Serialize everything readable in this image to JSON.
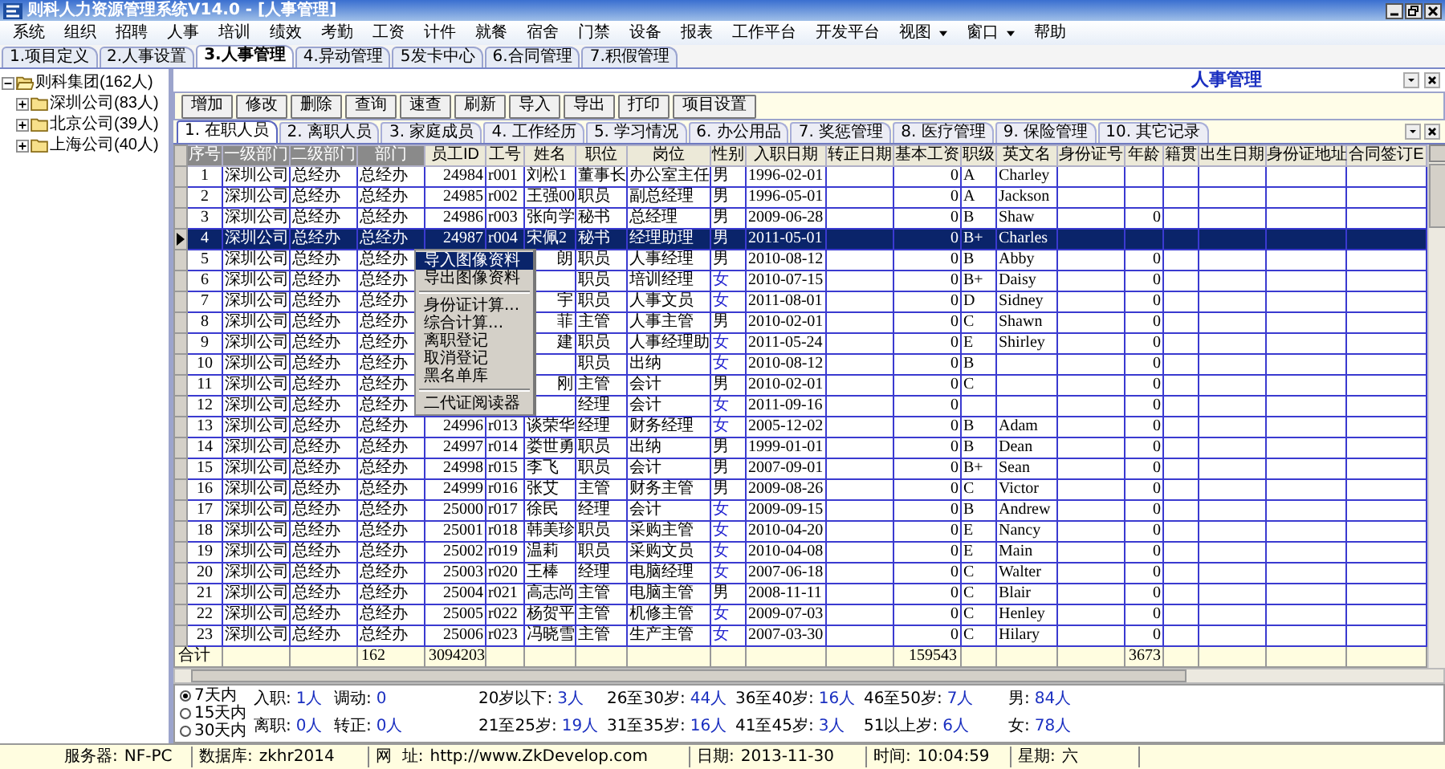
{
  "window": {
    "title": "则科人力资源管理系统V14.0 - [人事管理]"
  },
  "menu": [
    {
      "label": "系统",
      "dropdown": false
    },
    {
      "label": "组织",
      "dropdown": false
    },
    {
      "label": "招聘",
      "dropdown": false
    },
    {
      "label": "人事",
      "dropdown": false
    },
    {
      "label": "培训",
      "dropdown": false
    },
    {
      "label": "绩效",
      "dropdown": false
    },
    {
      "label": "考勤",
      "dropdown": false
    },
    {
      "label": "工资",
      "dropdown": false
    },
    {
      "label": "计件",
      "dropdown": false
    },
    {
      "label": "就餐",
      "dropdown": false
    },
    {
      "label": "宿舍",
      "dropdown": false
    },
    {
      "label": "门禁",
      "dropdown": false
    },
    {
      "label": "设备",
      "dropdown": false
    },
    {
      "label": "报表",
      "dropdown": false
    },
    {
      "label": "工作平台",
      "dropdown": false
    },
    {
      "label": "开发平台",
      "dropdown": false
    },
    {
      "label": "视图",
      "dropdown": true
    },
    {
      "label": "窗口",
      "dropdown": true
    },
    {
      "label": "帮助",
      "dropdown": false
    }
  ],
  "module_tabs": [
    {
      "label": "1.项目定义",
      "selected": false
    },
    {
      "label": "2.人事设置",
      "selected": false
    },
    {
      "label": "3.人事管理",
      "selected": true
    },
    {
      "label": "4.异动管理",
      "selected": false
    },
    {
      "label": "5发卡中心",
      "selected": false
    },
    {
      "label": "6.合同管理",
      "selected": false
    },
    {
      "label": "7.积假管理",
      "selected": false
    }
  ],
  "tree": {
    "label": "则科集团(162人)",
    "expanded": true,
    "children": [
      {
        "label": "深圳公司(83人)",
        "expanded": false
      },
      {
        "label": "北京公司(39人)",
        "expanded": false
      },
      {
        "label": "上海公司(40人)",
        "expanded": false
      }
    ]
  },
  "panel": {
    "title": "人事管理"
  },
  "toolbar": [
    "增加",
    "修改",
    "删除",
    "查询",
    "速查",
    "刷新",
    "导入",
    "导出",
    "打印",
    "项目设置"
  ],
  "record_tabs": [
    {
      "label": "1. 在职人员",
      "selected": true
    },
    {
      "label": "2. 离职人员",
      "selected": false
    },
    {
      "label": "3. 家庭成员",
      "selected": false
    },
    {
      "label": "4. 工作经历",
      "selected": false
    },
    {
      "label": "5. 学习情况",
      "selected": false
    },
    {
      "label": "6. 办公用品",
      "selected": false
    },
    {
      "label": "7. 奖惩管理",
      "selected": false
    },
    {
      "label": "8. 医疗管理",
      "selected": false
    },
    {
      "label": "9. 保险管理",
      "selected": false
    },
    {
      "label": "10. 其它记录",
      "selected": false
    }
  ],
  "table": {
    "columns": [
      {
        "label": "序号",
        "dim": true,
        "kind": "text"
      },
      {
        "label": "一级部门",
        "dim": true,
        "kind": "text"
      },
      {
        "label": "二级部门",
        "dim": true,
        "kind": "text"
      },
      {
        "label": "部门",
        "dim": true,
        "kind": "text"
      },
      {
        "label": "员工ID",
        "dim": false,
        "kind": "number"
      },
      {
        "label": "工号",
        "dim": false,
        "kind": "text"
      },
      {
        "label": "姓名",
        "dim": false,
        "kind": "text"
      },
      {
        "label": "职位",
        "dim": false,
        "kind": "text"
      },
      {
        "label": "岗位",
        "dim": false,
        "kind": "text"
      },
      {
        "label": "性别",
        "dim": false,
        "kind": "gender"
      },
      {
        "label": "入职日期",
        "dim": false,
        "kind": "text"
      },
      {
        "label": "转正日期",
        "dim": false,
        "kind": "text"
      },
      {
        "label": "基本工资",
        "dim": false,
        "kind": "number"
      },
      {
        "label": "职级",
        "dim": false,
        "kind": "text"
      },
      {
        "label": "英文名",
        "dim": false,
        "kind": "text"
      },
      {
        "label": "身份证号",
        "dim": false,
        "kind": "text"
      },
      {
        "label": "年龄",
        "dim": false,
        "kind": "number"
      },
      {
        "label": "籍贯",
        "dim": false,
        "kind": "text"
      },
      {
        "label": "出生日期",
        "dim": false,
        "kind": "text"
      },
      {
        "label": "身份证地址",
        "dim": false,
        "kind": "text"
      },
      {
        "label": "合同签订E",
        "dim": false,
        "kind": "text"
      }
    ],
    "rows": [
      {
        "no": "1",
        "dept1": "深圳公司",
        "dept2": "总经办",
        "dept": "总经办",
        "emp_id": "24984",
        "emp_no": "r001",
        "name": "刘松1",
        "position": "董事长",
        "post": "办公室主任",
        "gender": "男",
        "hire_date": "1996-02-01",
        "base_salary": "0",
        "grade": "A",
        "english_name": "Charley",
        "selected": false,
        "gender_blue": false,
        "under_menu": false
      },
      {
        "no": "2",
        "dept1": "深圳公司",
        "dept2": "总经办",
        "dept": "总经办",
        "emp_id": "24985",
        "emp_no": "r002",
        "name": "王强00",
        "position": "职员",
        "post": "副总经理",
        "gender": "男",
        "hire_date": "1996-05-01",
        "base_salary": "0",
        "grade": "A",
        "english_name": "Jackson",
        "selected": false,
        "gender_blue": false,
        "under_menu": false
      },
      {
        "no": "3",
        "dept1": "深圳公司",
        "dept2": "总经办",
        "dept": "总经办",
        "emp_id": "24986",
        "emp_no": "r003",
        "name": "张向学",
        "position": "秘书",
        "post": "总经理",
        "gender": "男",
        "hire_date": "2009-06-28",
        "base_salary": "0",
        "grade": "B",
        "english_name": "Shaw",
        "age": "0",
        "selected": false,
        "gender_blue": false,
        "under_menu": false
      },
      {
        "no": "4",
        "dept1": "深圳公司",
        "dept2": "总经办",
        "dept": "总经办",
        "emp_id": "24987",
        "emp_no": "r004",
        "name": "宋佩2",
        "position": "秘书",
        "post": "经理助理",
        "gender": "男",
        "hire_date": "2011-05-01",
        "base_salary": "0",
        "grade": "B+",
        "english_name": "Charles",
        "selected": true,
        "gender_blue": false,
        "under_menu": false
      },
      {
        "no": "5",
        "dept1": "深圳公司",
        "dept2": "总经办",
        "dept": "总经办",
        "name": "朗",
        "position": "职员",
        "post": "人事经理",
        "gender": "男",
        "hire_date": "2010-08-12",
        "base_salary": "0",
        "grade": "B",
        "english_name": "Abby",
        "age": "0",
        "selected": false,
        "gender_blue": false,
        "under_menu": true
      },
      {
        "no": "6",
        "dept1": "深圳公司",
        "dept2": "总经办",
        "dept": "总经办",
        "position": "职员",
        "post": "培训经理",
        "gender": "女",
        "hire_date": "2010-07-15",
        "base_salary": "0",
        "grade": "B+",
        "english_name": "Daisy",
        "age": "0",
        "selected": false,
        "gender_blue": true,
        "under_menu": true
      },
      {
        "no": "7",
        "dept1": "深圳公司",
        "dept2": "总经办",
        "dept": "总经办",
        "name": "宇",
        "position": "职员",
        "post": "人事文员",
        "gender": "女",
        "hire_date": "2011-08-01",
        "base_salary": "0",
        "grade": "D",
        "english_name": "Sidney",
        "age": "0",
        "selected": false,
        "gender_blue": true,
        "under_menu": true
      },
      {
        "no": "8",
        "dept1": "深圳公司",
        "dept2": "总经办",
        "dept": "总经办",
        "name": "菲",
        "position": "主管",
        "post": "人事主管",
        "gender": "男",
        "hire_date": "2010-02-01",
        "base_salary": "0",
        "grade": "C",
        "english_name": "Shawn",
        "age": "0",
        "selected": false,
        "gender_blue": false,
        "under_menu": true
      },
      {
        "no": "9",
        "dept1": "深圳公司",
        "dept2": "总经办",
        "dept": "总经办",
        "name": "建",
        "position": "职员",
        "post": "人事经理助",
        "gender": "女",
        "hire_date": "2011-05-24",
        "base_salary": "0",
        "grade": "E",
        "english_name": "Shirley",
        "age": "0",
        "selected": false,
        "gender_blue": true,
        "under_menu": true
      },
      {
        "no": "10",
        "dept1": "深圳公司",
        "dept2": "总经办",
        "dept": "总经办",
        "position": "职员",
        "post": "出纳",
        "gender": "女",
        "hire_date": "2010-08-12",
        "base_salary": "0",
        "grade": "B",
        "age": "0",
        "selected": false,
        "gender_blue": true,
        "under_menu": true
      },
      {
        "no": "11",
        "dept1": "深圳公司",
        "dept2": "总经办",
        "dept": "总经办",
        "name": "刚",
        "position": "主管",
        "post": "会计",
        "gender": "男",
        "hire_date": "2010-02-01",
        "base_salary": "0",
        "grade": "C",
        "age": "0",
        "selected": false,
        "gender_blue": false,
        "under_menu": true
      },
      {
        "no": "12",
        "dept1": "深圳公司",
        "dept2": "总经办",
        "dept": "总经办",
        "position": "经理",
        "post": "会计",
        "gender": "女",
        "hire_date": "2011-09-16",
        "base_salary": "0",
        "age": "0",
        "selected": false,
        "gender_blue": true,
        "under_menu": true
      },
      {
        "no": "13",
        "dept1": "深圳公司",
        "dept2": "总经办",
        "dept": "总经办",
        "emp_id": "24996",
        "emp_no": "r013",
        "name": "谈荣华",
        "position": "经理",
        "post": "财务经理",
        "gender": "女",
        "hire_date": "2005-12-02",
        "base_salary": "0",
        "grade": "B",
        "english_name": "Adam",
        "age": "0",
        "selected": false,
        "gender_blue": true,
        "under_menu": false
      },
      {
        "no": "14",
        "dept1": "深圳公司",
        "dept2": "总经办",
        "dept": "总经办",
        "emp_id": "24997",
        "emp_no": "r014",
        "name": "娄世勇",
        "position": "职员",
        "post": "出纳",
        "gender": "男",
        "hire_date": "1999-01-01",
        "base_salary": "0",
        "grade": "B",
        "english_name": "Dean",
        "age": "0",
        "selected": false,
        "gender_blue": false,
        "under_menu": false
      },
      {
        "no": "15",
        "dept1": "深圳公司",
        "dept2": "总经办",
        "dept": "总经办",
        "emp_id": "24998",
        "emp_no": "r015",
        "name": "李飞",
        "position": "职员",
        "post": "会计",
        "gender": "男",
        "hire_date": "2007-09-01",
        "base_salary": "0",
        "grade": "B+",
        "english_name": "Sean",
        "age": "0",
        "selected": false,
        "gender_blue": false,
        "under_menu": false
      },
      {
        "no": "16",
        "dept1": "深圳公司",
        "dept2": "总经办",
        "dept": "总经办",
        "emp_id": "24999",
        "emp_no": "r016",
        "name": "张艾",
        "position": "主管",
        "post": "财务主管",
        "gender": "男",
        "hire_date": "2009-08-26",
        "base_salary": "0",
        "grade": "C",
        "english_name": "Victor",
        "age": "0",
        "selected": false,
        "gender_blue": false,
        "under_menu": false
      },
      {
        "no": "17",
        "dept1": "深圳公司",
        "dept2": "总经办",
        "dept": "总经办",
        "emp_id": "25000",
        "emp_no": "r017",
        "name": "徐民",
        "position": "经理",
        "post": "会计",
        "gender": "女",
        "hire_date": "2009-09-15",
        "base_salary": "0",
        "grade": "B",
        "english_name": "Andrew",
        "age": "0",
        "selected": false,
        "gender_blue": true,
        "under_menu": false
      },
      {
        "no": "18",
        "dept1": "深圳公司",
        "dept2": "总经办",
        "dept": "总经办",
        "emp_id": "25001",
        "emp_no": "r018",
        "name": "韩美珍",
        "position": "职员",
        "post": "采购主管",
        "gender": "女",
        "hire_date": "2010-04-20",
        "base_salary": "0",
        "grade": "E",
        "english_name": "Nancy",
        "age": "0",
        "selected": false,
        "gender_blue": true,
        "under_menu": false
      },
      {
        "no": "19",
        "dept1": "深圳公司",
        "dept2": "总经办",
        "dept": "总经办",
        "emp_id": "25002",
        "emp_no": "r019",
        "name": "温莉",
        "position": "职员",
        "post": "采购文员",
        "gender": "女",
        "hire_date": "2010-04-08",
        "base_salary": "0",
        "grade": "E",
        "english_name": "Main",
        "age": "0",
        "selected": false,
        "gender_blue": true,
        "under_menu": false
      },
      {
        "no": "20",
        "dept1": "深圳公司",
        "dept2": "总经办",
        "dept": "总经办",
        "emp_id": "25003",
        "emp_no": "r020",
        "name": "王棒",
        "position": "经理",
        "post": "电脑经理",
        "gender": "女",
        "hire_date": "2007-06-18",
        "base_salary": "0",
        "grade": "C",
        "english_name": "Walter",
        "age": "0",
        "selected": false,
        "gender_blue": true,
        "under_menu": false
      },
      {
        "no": "21",
        "dept1": "深圳公司",
        "dept2": "总经办",
        "dept": "总经办",
        "emp_id": "25004",
        "emp_no": "r021",
        "name": "高志尚",
        "position": "主管",
        "post": "电脑主管",
        "gender": "男",
        "hire_date": "2008-11-11",
        "base_salary": "0",
        "grade": "C",
        "english_name": "Blair",
        "age": "0",
        "selected": false,
        "gender_blue": false,
        "under_menu": false
      },
      {
        "no": "22",
        "dept1": "深圳公司",
        "dept2": "总经办",
        "dept": "总经办",
        "emp_id": "25005",
        "emp_no": "r022",
        "name": "杨贺平",
        "position": "主管",
        "post": "机修主管",
        "gender": "女",
        "hire_date": "2009-07-03",
        "base_salary": "0",
        "grade": "C",
        "english_name": "Henley",
        "age": "0",
        "selected": false,
        "gender_blue": true,
        "under_menu": false
      },
      {
        "no": "23",
        "dept1": "深圳公司",
        "dept2": "总经办",
        "dept": "总经办",
        "emp_id": "25006",
        "emp_no": "r023",
        "name": "冯晓雪",
        "position": "主管",
        "post": "生产主管",
        "gender": "女",
        "hire_date": "2007-03-30",
        "base_salary": "0",
        "grade": "C",
        "english_name": "Hilary",
        "age": "0",
        "selected": false,
        "gender_blue": true,
        "under_menu": false
      }
    ],
    "totals": {
      "no": "合计",
      "dept": "162",
      "emp_id": "3094203",
      "base_salary": "159543",
      "age": "3673"
    }
  },
  "context_menu": {
    "items": [
      {
        "kind": "item",
        "label": "导入图像资料",
        "selected": true
      },
      {
        "kind": "item",
        "label": "导出图像资料",
        "selected": false
      },
      {
        "kind": "separator"
      },
      {
        "kind": "item",
        "label": "身份证计算...",
        "selected": false
      },
      {
        "kind": "item",
        "label": "综合计算...",
        "selected": false
      },
      {
        "kind": "item",
        "label": "离职登记",
        "selected": false
      },
      {
        "kind": "item",
        "label": "取消登记",
        "selected": false
      },
      {
        "kind": "item",
        "label": "黑名单库",
        "selected": false
      },
      {
        "kind": "separator"
      },
      {
        "kind": "item",
        "label": "二代证阅读器",
        "selected": false
      }
    ]
  },
  "stats": {
    "periods": [
      {
        "label": "7天内",
        "selected": true
      },
      {
        "label": "15天内",
        "selected": false
      },
      {
        "label": "30天内",
        "selected": false
      }
    ],
    "groups": [
      [
        {
          "label": "入职:",
          "value": "1人"
        },
        {
          "label": "离职:",
          "value": "0人"
        }
      ],
      [
        {
          "label": "调动:",
          "value": "0"
        },
        {
          "label": "转正:",
          "value": "0人"
        }
      ],
      [
        {
          "label": "20岁以下:",
          "value": "3人"
        },
        {
          "label": "21至25岁:",
          "value": "19人"
        }
      ],
      [
        {
          "label": "26至30岁:",
          "value": "44人"
        },
        {
          "label": "31至35岁:",
          "value": "16人"
        }
      ],
      [
        {
          "label": "36至40岁:",
          "value": "16人"
        },
        {
          "label": "41至45岁:",
          "value": "3人"
        }
      ],
      [
        {
          "label": "46至50岁:",
          "value": "7人"
        },
        {
          "label": "51以上岁:",
          "value": "6人"
        }
      ],
      [
        {
          "label": "男:",
          "value": "84人"
        },
        {
          "label": "女:",
          "value": "78人"
        }
      ]
    ]
  },
  "status_bar": [
    {
      "label": "服务器:",
      "value": "NF-PC"
    },
    {
      "label": "数据库:",
      "value": "zkhr2014"
    },
    {
      "label": "网  址:",
      "value": "http://www.ZkDevelop.com"
    },
    {
      "label": "日期:",
      "value": "2013-11-30"
    },
    {
      "label": "时间:",
      "value": "10:04:59"
    },
    {
      "label": "星期:",
      "value": "六"
    }
  ]
}
